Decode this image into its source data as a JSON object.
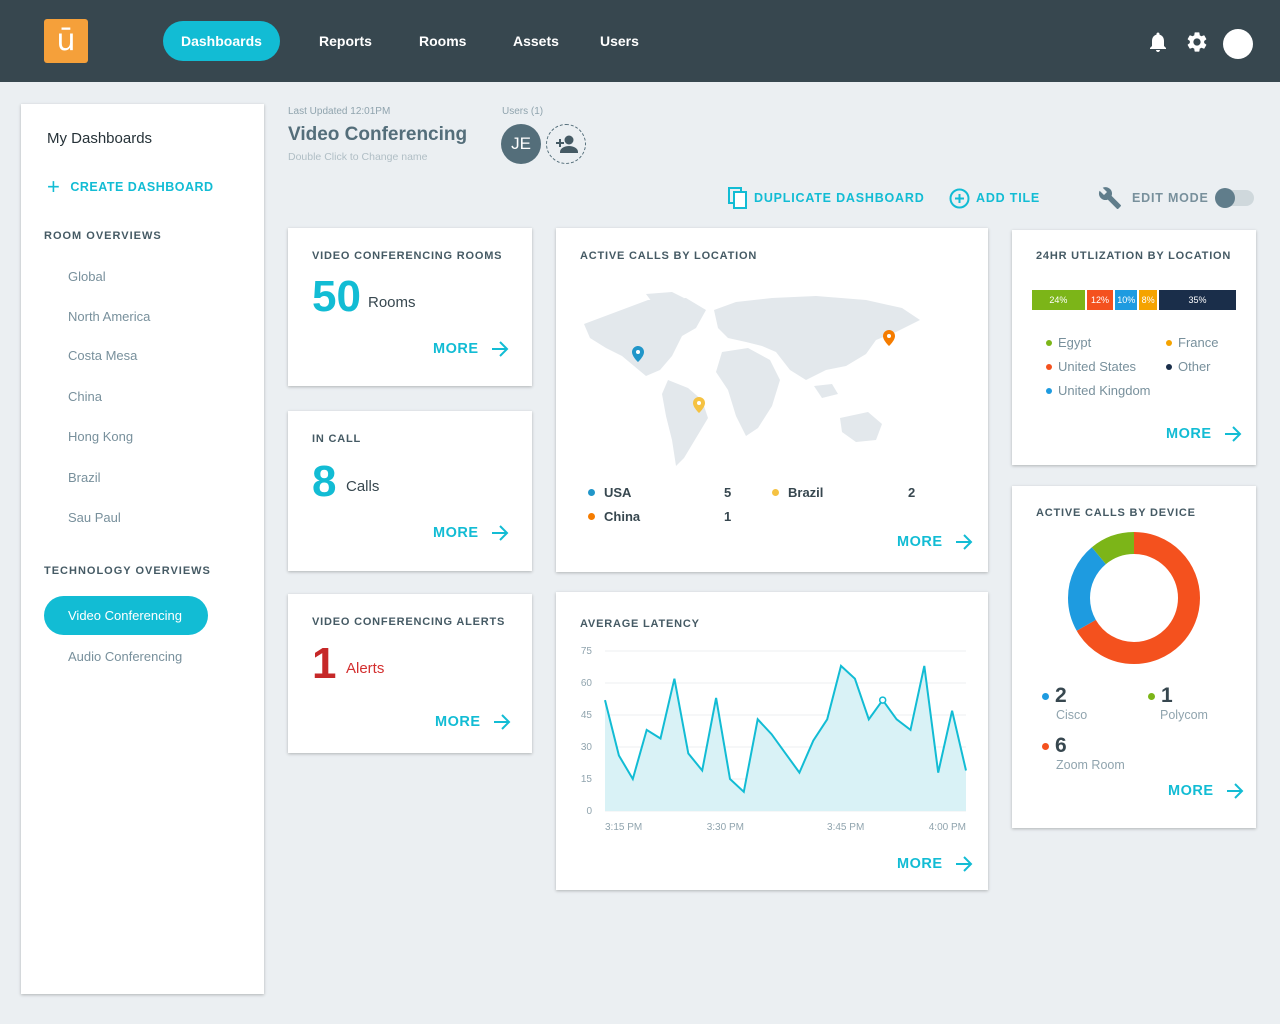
{
  "app": {
    "logo_glyph": "ū",
    "brand_color": "#f5a03a",
    "accent_color": "#12bcd4"
  },
  "nav": {
    "items": [
      {
        "label": "Dashboards",
        "active": true
      },
      {
        "label": "Reports"
      },
      {
        "label": "Rooms"
      },
      {
        "label": "Assets"
      },
      {
        "label": "Users"
      }
    ],
    "icons": [
      "bell-icon",
      "gear-icon",
      "avatar"
    ]
  },
  "sidebar": {
    "title": "My Dashboards",
    "create_label": "CREATE DASHBOARD",
    "room_section": "ROOM OVERVIEWS",
    "rooms": [
      "Global",
      "North America",
      "Costa Mesa",
      "China",
      "Hong Kong",
      "Brazil",
      "Sau Paul"
    ],
    "tech_section": "TECHNOLOGY OVERVIEWS",
    "tech": [
      "Video Conferencing",
      "Audio Conferencing"
    ]
  },
  "header": {
    "last_updated": "Last Updated 12:01PM",
    "title": "Video Conferencing",
    "subtitle": "Double Click to Change name",
    "users_label": "Users (1)",
    "user_initials": "JE",
    "duplicate_label": "DUPLICATE DASHBOARD",
    "add_tile_label": "ADD TILE",
    "edit_mode_label": "EDIT MODE"
  },
  "tiles": {
    "rooms": {
      "title": "VIDEO CONFERENCING ROOMS",
      "value": "50",
      "unit": "Rooms",
      "more": "MORE"
    },
    "in_call": {
      "title": "IN CALL",
      "value": "8",
      "unit": "Calls",
      "more": "MORE"
    },
    "alerts": {
      "title": "VIDEO CONFERENCING ALERTS",
      "value": "1",
      "unit": "Alerts",
      "more": "MORE",
      "color": "#d32f2f"
    },
    "active_calls_location": {
      "title": "ACTIVE CALLS BY LOCATION",
      "more": "MORE",
      "legend": [
        {
          "name": "USA",
          "value": "5",
          "color": "#2196c9"
        },
        {
          "name": "Brazil",
          "value": "2",
          "color": "#f5c242"
        },
        {
          "name": "China",
          "value": "1",
          "color": "#f57c00"
        }
      ]
    },
    "utilization": {
      "title": "24HR UTLIZATION BY LOCATION",
      "more": "MORE",
      "bars": [
        {
          "label": "24%",
          "value": 24,
          "color": "#7cb518"
        },
        {
          "label": "12%",
          "value": 12,
          "color": "#f4511e"
        },
        {
          "label": "10%",
          "value": 10,
          "color": "#1e9be0"
        },
        {
          "label": "8%",
          "value": 8,
          "color": "#f5a300"
        },
        {
          "label": "35%",
          "value": 35,
          "color": "#1a2e4a"
        }
      ],
      "legend": [
        {
          "name": "Egypt",
          "color": "#7cb518"
        },
        {
          "name": "France",
          "color": "#f5a300"
        },
        {
          "name": "United States",
          "color": "#f4511e"
        },
        {
          "name": "Other",
          "color": "#1a2e4a"
        },
        {
          "name": "United Kingdom",
          "color": "#1e9be0"
        }
      ]
    },
    "latency": {
      "title": "AVERAGE LATENCY",
      "more": "MORE"
    },
    "devices": {
      "title": "ACTIVE CALLS BY DEVICE",
      "more": "MORE",
      "items": [
        {
          "name": "Cisco",
          "value": "2",
          "color": "#1e9be0"
        },
        {
          "name": "Polycom",
          "value": "1",
          "color": "#7cb518"
        },
        {
          "name": "Zoom Room",
          "value": "6",
          "color": "#f4511e"
        }
      ]
    }
  },
  "chart_data": [
    {
      "type": "area",
      "title": "AVERAGE LATENCY",
      "x_ticks": [
        "3:15 PM",
        "3:30 PM",
        "3:45 PM",
        "4:00 PM"
      ],
      "y_ticks": [
        0,
        15,
        30,
        45,
        60,
        75
      ],
      "ylim": [
        0,
        75
      ],
      "values": [
        52,
        26,
        15,
        38,
        34,
        62,
        27,
        19,
        53,
        15,
        9,
        43,
        36,
        27,
        18,
        33,
        43,
        68,
        62,
        43,
        52,
        43,
        38,
        68,
        18,
        47,
        19
      ],
      "color": "#12bcd4"
    },
    {
      "type": "pie",
      "title": "ACTIVE CALLS BY DEVICE",
      "labels": [
        "Cisco",
        "Polycom",
        "Zoom Room"
      ],
      "values": [
        2,
        1,
        6
      ],
      "colors": [
        "#1e9be0",
        "#7cb518",
        "#f4511e"
      ]
    }
  ]
}
